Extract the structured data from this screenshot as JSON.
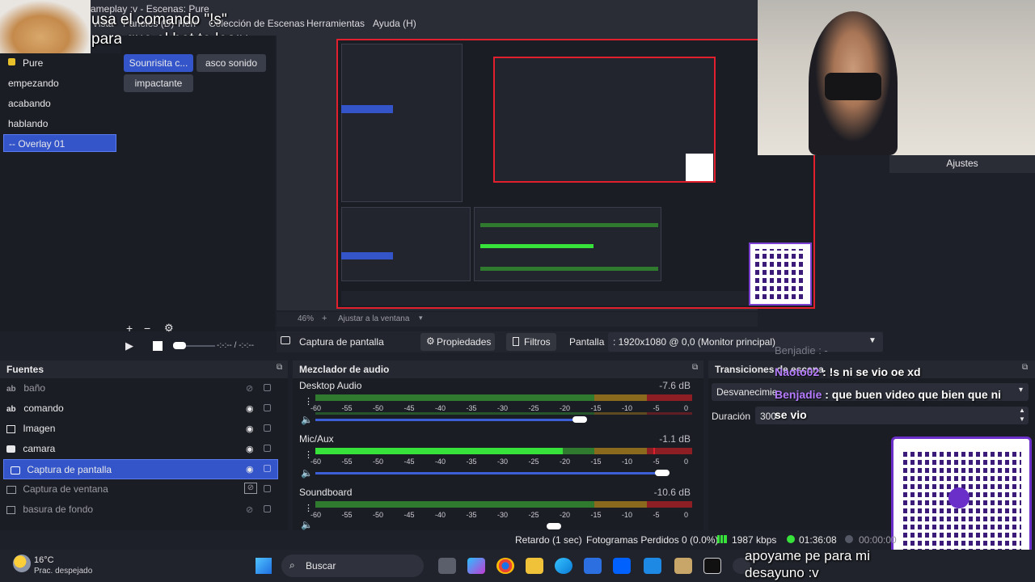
{
  "window": {
    "title_fragment": "ameplay :v - Escenas: Pure"
  },
  "menu": {
    "items": [
      "Vista",
      "Paneles (D)",
      "Herr",
      "Colección de Escenas",
      "Herramientas",
      "Ayuda (H)"
    ]
  },
  "overlay": {
    "line1": "usa el comando \"!s\"",
    "line2": "para que el bot te lea:v"
  },
  "scenes": {
    "items": [
      "Pure",
      "empezando",
      "acabando",
      "hablando",
      "-- Overlay 01"
    ],
    "selected": "-- Overlay 01"
  },
  "scene_sources": {
    "buttons": [
      "Sounrisita c...",
      "asco sonido",
      "impactante"
    ]
  },
  "settings_label": "Ajustes",
  "zoom": {
    "percent": "46%",
    "fit": "Ajustar a la ventana"
  },
  "media": {
    "time": "-:-:-- / -:-:--"
  },
  "propbar": {
    "source": "Captura de pantalla",
    "properties": "Propiedades",
    "filters": "Filtros",
    "screen_label": "Pantalla",
    "screen_value": ": 1920x1080 @ 0,0 (Monitor principal)"
  },
  "sources": {
    "title": "Fuentes",
    "items": [
      {
        "name": "baño",
        "dim": true
      },
      {
        "name": "comando",
        "dim": false
      },
      {
        "name": "Imagen",
        "dim": false
      },
      {
        "name": "camara",
        "dim": false
      },
      {
        "name": "Captura de pantalla",
        "dim": false,
        "selected": true
      },
      {
        "name": "Captura de ventana",
        "dim": true
      },
      {
        "name": "basura de fondo",
        "dim": true
      }
    ]
  },
  "mixer": {
    "title": "Mezclador de audio",
    "ticks": [
      "-60",
      "-55",
      "-50",
      "-45",
      "-40",
      "-35",
      "-30",
      "-25",
      "-20",
      "-15",
      "-10",
      "-5",
      "0"
    ],
    "channels": [
      {
        "name": "Desktop Audio",
        "db": "-7.6 dB",
        "level": 0.0,
        "volume": 0.86
      },
      {
        "name": "Mic/Aux",
        "db": "-1.1 dB",
        "level": 0.65,
        "volume": 0.93
      },
      {
        "name": "Soundboard",
        "db": "-10.6 dB",
        "level": 0.0,
        "volume": 0.7
      }
    ]
  },
  "transitions": {
    "title": "Transiciones de escena",
    "type": "Desvanecimie",
    "duration_label": "Duración",
    "duration_value": "300"
  },
  "chat": {
    "ghost": "Benjadie : -",
    "msg1_user": "Naoto02",
    "msg1_text": " : !s ni se vio oe xd",
    "msg2_user": "Benjadie",
    "msg2_text": " : que buen video que bien que ni",
    "msg2_cont": "se vio"
  },
  "status": {
    "delay": "Retardo (1 sec)",
    "dropped": "Fotogramas Perdidos 0 (0.0%)",
    "kbps": "1987 kbps",
    "time": "01:36:08",
    "rec": "00:00:00"
  },
  "taskbar": {
    "temp": "16°C",
    "weather": "Prac. despejado",
    "search": "Buscar",
    "donate_line1": "apoyame pe para mi",
    "donate_line2": "desayuno :v"
  },
  "colors": {
    "accent": "#3355c9",
    "preview_border": "#e2202d",
    "meter_green": "#37e33a",
    "chat_user": "#b57cff"
  }
}
